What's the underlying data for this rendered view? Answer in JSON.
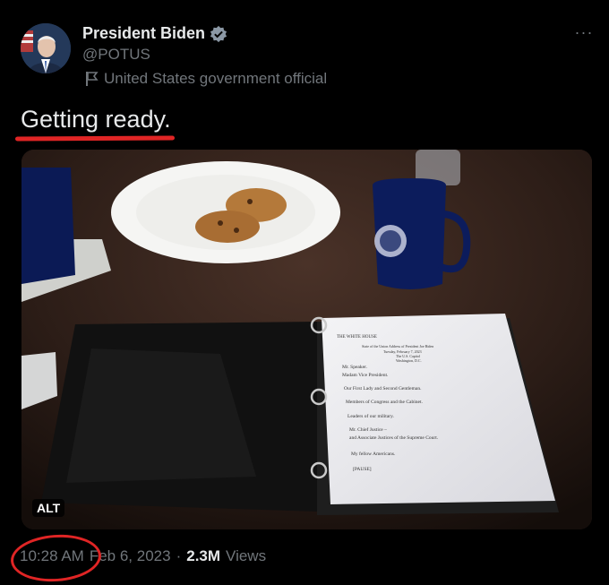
{
  "author": {
    "name": "President Biden",
    "handle": "@POTUS",
    "label": "United States government official",
    "avatar_icon": "avatar-photo",
    "verified_color": "#8b98a5"
  },
  "menu": {
    "more_glyph": "···"
  },
  "tweet": {
    "text": "Getting ready."
  },
  "media": {
    "alt_label": "ALT",
    "document_lines": [
      "THE WHITE HOUSE",
      "State of the Union Address of President Joe Biden",
      "Tuesday, February 7, 2023",
      "The U.S. Capitol",
      "Washington, D.C.",
      "Mr. Speaker.",
      "Madam Vice President.",
      "Our First Lady and Second Gentleman.",
      "Members of Congress and the Cabinet.",
      "Leaders of our military.",
      "Mr. Chief Justice –",
      "and Associate Justices of the Supreme Court.",
      "My fellow Americans.",
      "[PAUSE]"
    ]
  },
  "meta": {
    "time": "10:28 AM",
    "separator": "·",
    "date": "Feb 6, 2023",
    "views_count": "2.3M",
    "views_label": "Views"
  },
  "annotation_color": "#e02525"
}
